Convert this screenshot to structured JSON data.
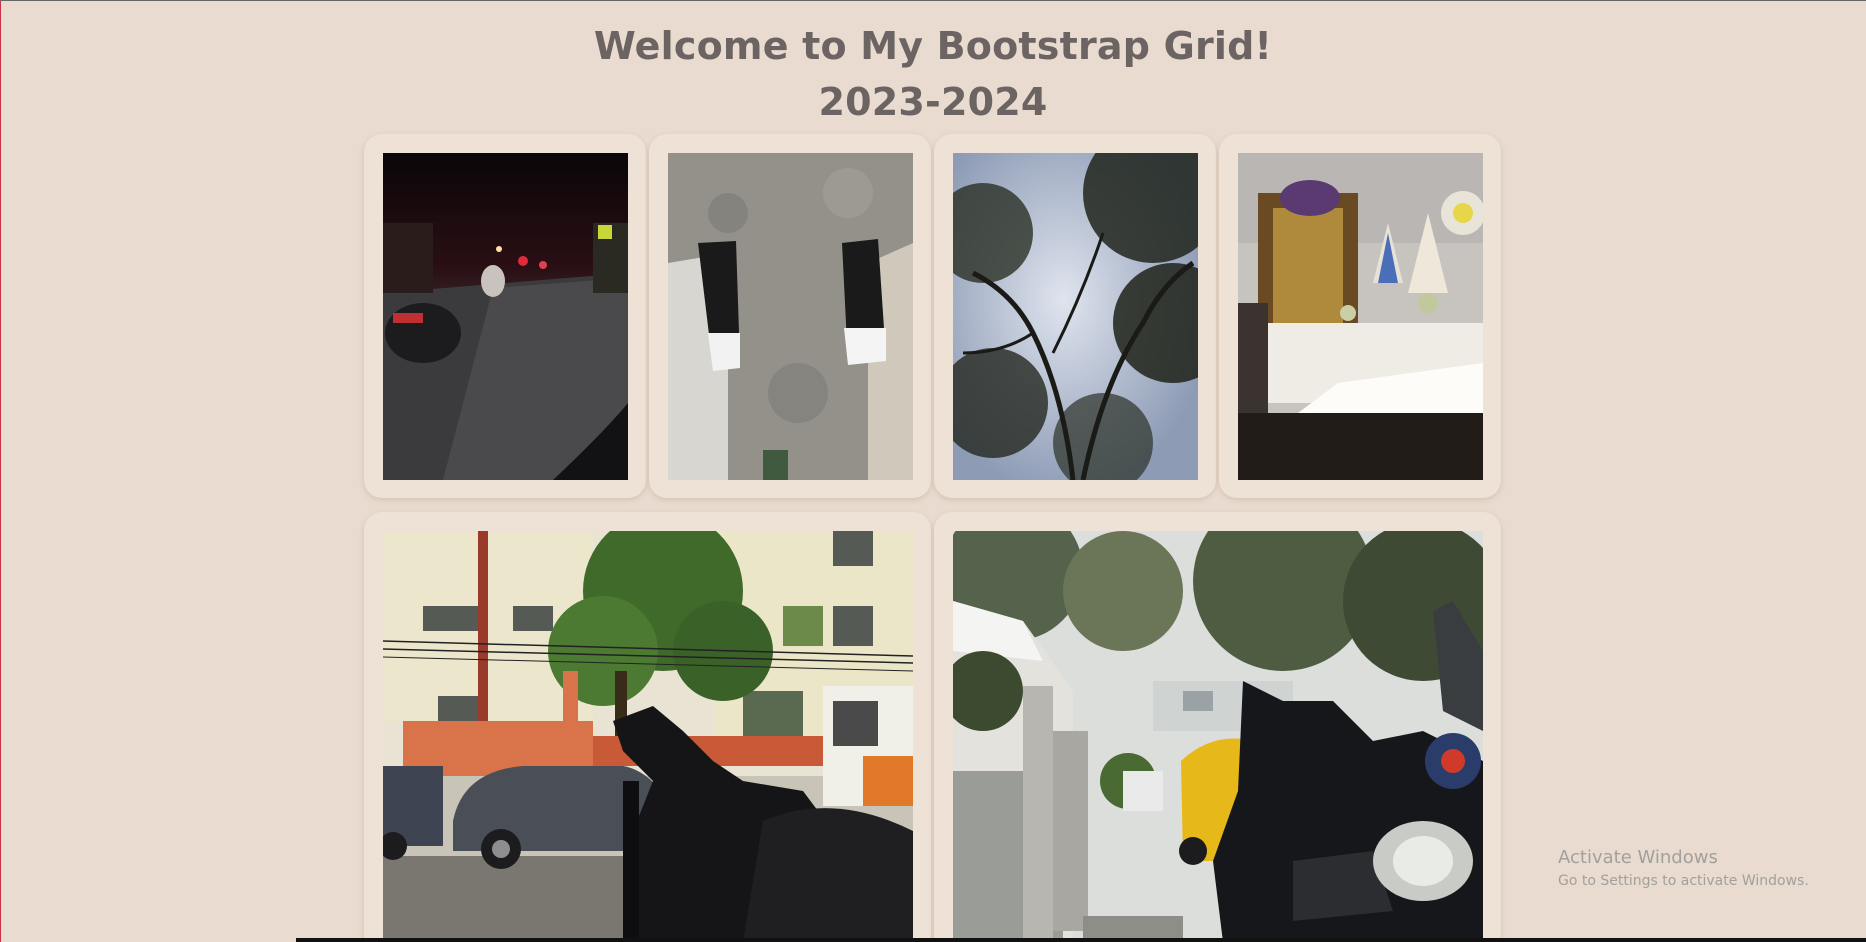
{
  "header": {
    "title": "Welcome to My Bootstrap Grid!",
    "subtitle": "2023-2024"
  },
  "gallery": {
    "row1": [
      {
        "subject": "night-street"
      },
      {
        "subject": "sneakers-on-concrete"
      },
      {
        "subject": "tree-canopy"
      },
      {
        "subject": "church-altar"
      }
    ],
    "row2": [
      {
        "subject": "rainy-street-motorcycle"
      },
      {
        "subject": "alley-parked-motorcycles"
      }
    ]
  },
  "watermark": {
    "title": "Activate Windows",
    "subtitle": "Go to Settings to activate Windows."
  },
  "colors": {
    "background": "#e9dbcf",
    "card": "#eee2d6",
    "heading": "#6b6462"
  }
}
